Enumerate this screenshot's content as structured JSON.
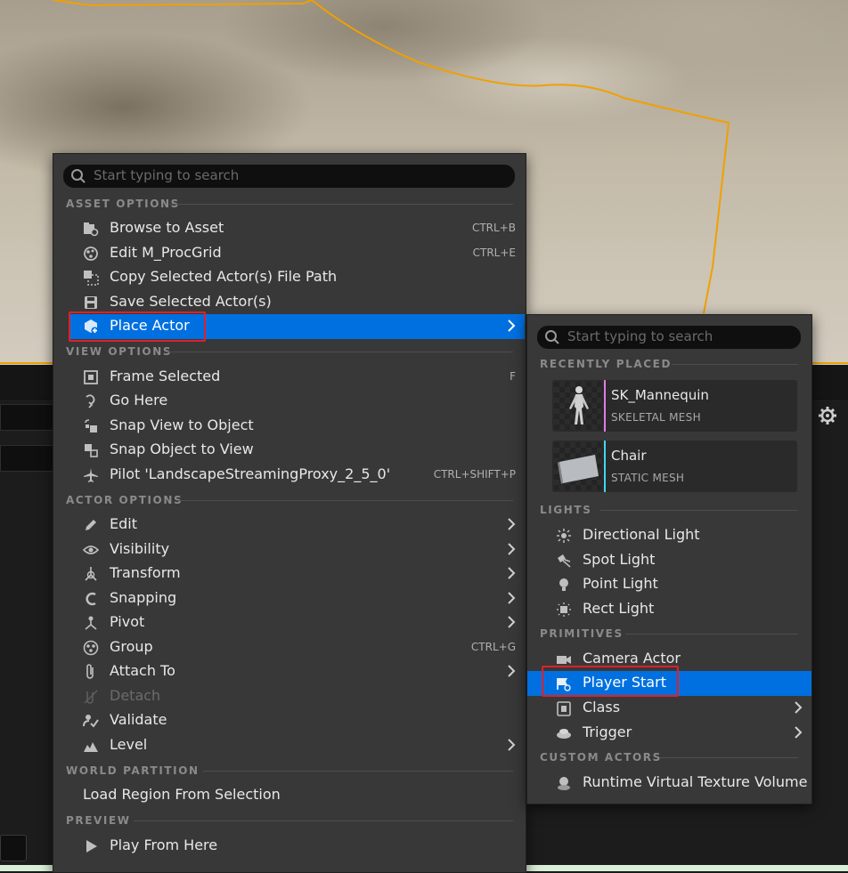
{
  "main_menu": {
    "search_placeholder": "Start typing to search",
    "sections": {
      "asset_options": "ASSET OPTIONS",
      "view_options": "VIEW OPTIONS",
      "actor_options": "ACTOR OPTIONS",
      "world_partition": "WORLD PARTITION",
      "preview": "PREVIEW"
    },
    "items": {
      "browse_to_asset": {
        "label": "Browse to Asset",
        "shortcut": "CTRL+B"
      },
      "edit_material": {
        "label": "Edit M_ProcGrid",
        "shortcut": "CTRL+E"
      },
      "copy_path": {
        "label": "Copy Selected Actor(s) File Path"
      },
      "save_actors": {
        "label": "Save Selected Actor(s)"
      },
      "place_actor": {
        "label": "Place Actor"
      },
      "frame_selected": {
        "label": "Frame Selected",
        "shortcut": "F"
      },
      "go_here": {
        "label": "Go Here"
      },
      "snap_view": {
        "label": "Snap View to Object"
      },
      "snap_object": {
        "label": "Snap Object to View"
      },
      "pilot": {
        "label": "Pilot 'LandscapeStreamingProxy_2_5_0'",
        "shortcut": "CTRL+SHIFT+P"
      },
      "edit": {
        "label": "Edit"
      },
      "visibility": {
        "label": "Visibility"
      },
      "transform": {
        "label": "Transform"
      },
      "snapping": {
        "label": "Snapping"
      },
      "pivot": {
        "label": "Pivot"
      },
      "group": {
        "label": "Group",
        "shortcut": "CTRL+G"
      },
      "attach_to": {
        "label": "Attach To"
      },
      "detach": {
        "label": "Detach"
      },
      "validate": {
        "label": "Validate"
      },
      "level": {
        "label": "Level"
      },
      "load_region": {
        "label": "Load Region From Selection"
      },
      "play_from_here": {
        "label": "Play From Here"
      }
    }
  },
  "sub_menu": {
    "search_placeholder": "Start typing to search",
    "sections": {
      "recently_placed": "RECENTLY PLACED",
      "lights": "LIGHTS",
      "primitives": "PRIMITIVES",
      "custom_actors": "CUSTOM ACTORS"
    },
    "recent": [
      {
        "name": "SK_Mannequin",
        "type": "SKELETAL MESH",
        "accent": "#e07ee0"
      },
      {
        "name": "Chair",
        "type": "STATIC MESH",
        "accent": "#3fd7f0"
      }
    ],
    "items": {
      "directional_light": "Directional Light",
      "spot_light": "Spot Light",
      "point_light": "Point Light",
      "rect_light": "Rect Light",
      "camera_actor": "Camera Actor",
      "player_start": "Player Start",
      "class": "Class",
      "trigger": "Trigger",
      "rvt_volume": "Runtime Virtual Texture Volume"
    }
  },
  "colors": {
    "highlight": "#0070e0",
    "annotation": "#e0202a",
    "selection_outline": "#f0a000"
  }
}
